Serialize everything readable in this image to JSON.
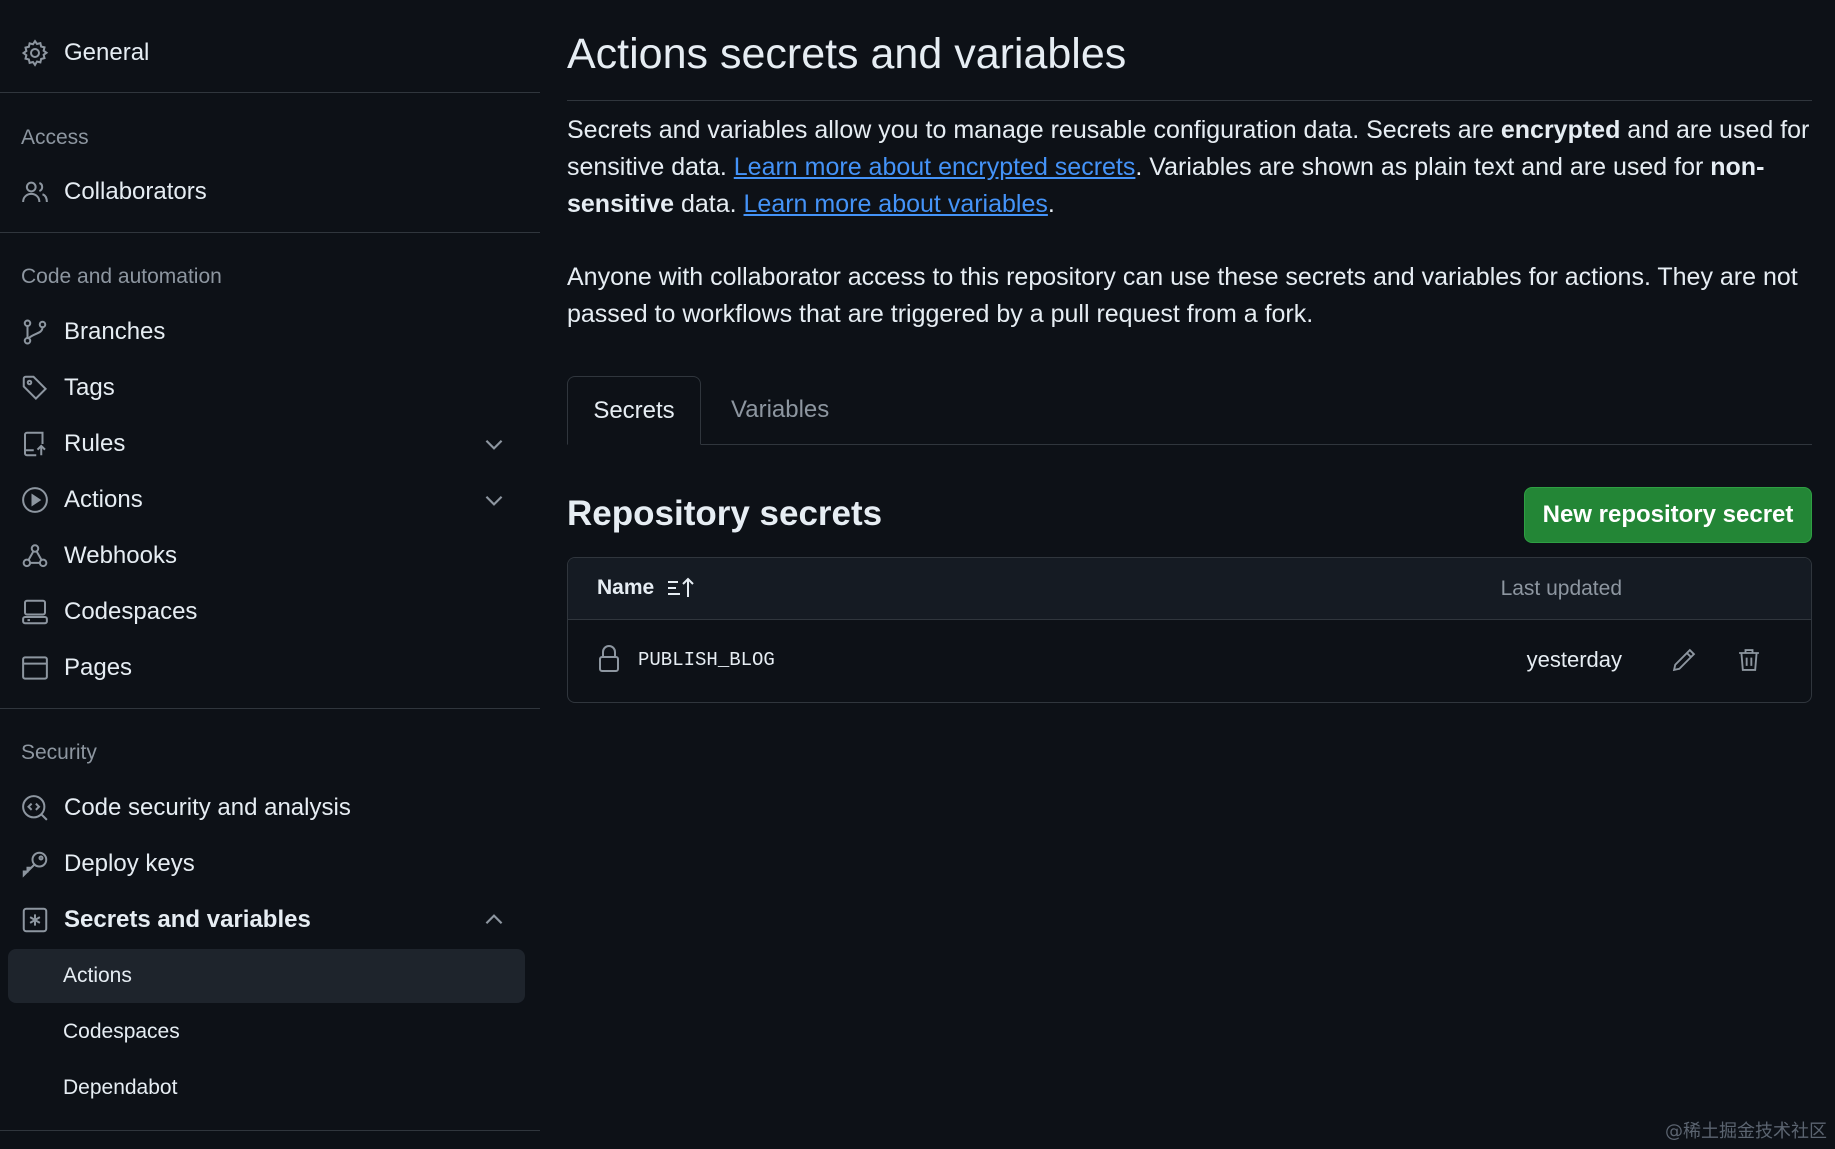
{
  "sidebar": {
    "general": "General",
    "groups": {
      "access": "Access",
      "code_automation": "Code and automation",
      "security": "Security"
    },
    "items": {
      "collaborators": "Collaborators",
      "branches": "Branches",
      "tags": "Tags",
      "rules": "Rules",
      "actions": "Actions",
      "webhooks": "Webhooks",
      "codespaces": "Codespaces",
      "pages": "Pages",
      "code_security": "Code security and analysis",
      "deploy_keys": "Deploy keys",
      "secrets_variables": "Secrets and variables"
    },
    "sub_items": {
      "actions": "Actions",
      "codespaces": "Codespaces",
      "dependabot": "Dependabot"
    },
    "active_sub_item": "Actions"
  },
  "main": {
    "title": "Actions secrets and variables",
    "intro": {
      "p1_a": "Secrets and variables allow you to manage reusable configuration data. Secrets are ",
      "p1_b": "encrypted",
      "p1_c": " and are used for sensitive data. ",
      "p1_link1": "Learn more about encrypted secrets",
      "p1_d": ". Variables are shown as plain text and are used for ",
      "p1_e": "non-sensitive",
      "p1_f": " data. ",
      "p1_link2": "Learn more about variables",
      "p1_g": ".",
      "p2": "Anyone with collaborator access to this repository can use these secrets and variables for actions. They are not passed to workflows that are triggered by a pull request from a fork."
    },
    "tabs": {
      "secrets": "Secrets",
      "variables": "Variables",
      "active": "Secrets"
    },
    "section_title": "Repository secrets",
    "new_button": "New repository secret",
    "table": {
      "col_name": "Name",
      "col_updated": "Last updated",
      "rows": [
        {
          "name": "PUBLISH_BLOG",
          "updated": "yesterday"
        }
      ]
    }
  },
  "watermark": "@稀土掘金技术社区",
  "colors": {
    "background": "#0d1117",
    "text": "#e6edf3",
    "muted": "#8d96a0",
    "link": "#4493f8",
    "button": "#238636",
    "border": "#30363d"
  },
  "icons": {
    "general": "gear-icon",
    "collaborators": "people-icon",
    "branches": "git-branch-icon",
    "tags": "tag-icon",
    "rules": "repo-push-icon",
    "actions": "play-icon",
    "webhooks": "webhook-icon",
    "codespaces": "codespaces-icon",
    "pages": "browser-icon",
    "code_security": "codescan-icon",
    "deploy_keys": "key-icon",
    "secrets_variables": "key-asterisk-icon",
    "sort": "sort-asc-icon",
    "lock": "lock-icon",
    "edit": "pencil-icon",
    "delete": "trash-icon"
  }
}
